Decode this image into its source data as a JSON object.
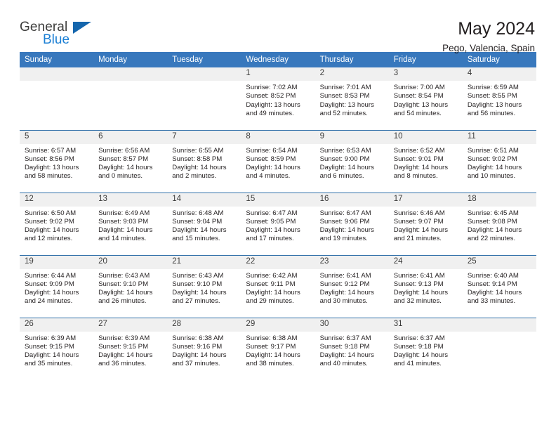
{
  "brand": {
    "name_part1": "General",
    "name_part2": "Blue",
    "triangle_icon": "brand-triangle-icon",
    "color_primary": "#1b7fd4",
    "color_dark": "#3c3c3b"
  },
  "header": {
    "title": "May 2024",
    "subtitle": "Pego, Valencia, Spain"
  },
  "theme": {
    "header_bg": "#3878bd",
    "daynum_bg": "#f0f0f0",
    "row_border": "#2f6fa8"
  },
  "weekday_headers": [
    "Sunday",
    "Monday",
    "Tuesday",
    "Wednesday",
    "Thursday",
    "Friday",
    "Saturday"
  ],
  "labels": {
    "sunrise_prefix": "Sunrise:",
    "sunset_prefix": "Sunset:",
    "daylight_prefix": "Daylight:"
  },
  "weeks": [
    [
      {
        "day": "",
        "sunrise": "",
        "sunset": "",
        "daylight": "",
        "empty": true
      },
      {
        "day": "",
        "sunrise": "",
        "sunset": "",
        "daylight": "",
        "empty": true
      },
      {
        "day": "",
        "sunrise": "",
        "sunset": "",
        "daylight": "",
        "empty": true
      },
      {
        "day": "1",
        "sunrise": "Sunrise: 7:02 AM",
        "sunset": "Sunset: 8:52 PM",
        "daylight": "Daylight: 13 hours and 49 minutes.",
        "empty": false
      },
      {
        "day": "2",
        "sunrise": "Sunrise: 7:01 AM",
        "sunset": "Sunset: 8:53 PM",
        "daylight": "Daylight: 13 hours and 52 minutes.",
        "empty": false
      },
      {
        "day": "3",
        "sunrise": "Sunrise: 7:00 AM",
        "sunset": "Sunset: 8:54 PM",
        "daylight": "Daylight: 13 hours and 54 minutes.",
        "empty": false
      },
      {
        "day": "4",
        "sunrise": "Sunrise: 6:59 AM",
        "sunset": "Sunset: 8:55 PM",
        "daylight": "Daylight: 13 hours and 56 minutes.",
        "empty": false
      }
    ],
    [
      {
        "day": "5",
        "sunrise": "Sunrise: 6:57 AM",
        "sunset": "Sunset: 8:56 PM",
        "daylight": "Daylight: 13 hours and 58 minutes.",
        "empty": false
      },
      {
        "day": "6",
        "sunrise": "Sunrise: 6:56 AM",
        "sunset": "Sunset: 8:57 PM",
        "daylight": "Daylight: 14 hours and 0 minutes.",
        "empty": false
      },
      {
        "day": "7",
        "sunrise": "Sunrise: 6:55 AM",
        "sunset": "Sunset: 8:58 PM",
        "daylight": "Daylight: 14 hours and 2 minutes.",
        "empty": false
      },
      {
        "day": "8",
        "sunrise": "Sunrise: 6:54 AM",
        "sunset": "Sunset: 8:59 PM",
        "daylight": "Daylight: 14 hours and 4 minutes.",
        "empty": false
      },
      {
        "day": "9",
        "sunrise": "Sunrise: 6:53 AM",
        "sunset": "Sunset: 9:00 PM",
        "daylight": "Daylight: 14 hours and 6 minutes.",
        "empty": false
      },
      {
        "day": "10",
        "sunrise": "Sunrise: 6:52 AM",
        "sunset": "Sunset: 9:01 PM",
        "daylight": "Daylight: 14 hours and 8 minutes.",
        "empty": false
      },
      {
        "day": "11",
        "sunrise": "Sunrise: 6:51 AM",
        "sunset": "Sunset: 9:02 PM",
        "daylight": "Daylight: 14 hours and 10 minutes.",
        "empty": false
      }
    ],
    [
      {
        "day": "12",
        "sunrise": "Sunrise: 6:50 AM",
        "sunset": "Sunset: 9:02 PM",
        "daylight": "Daylight: 14 hours and 12 minutes.",
        "empty": false
      },
      {
        "day": "13",
        "sunrise": "Sunrise: 6:49 AM",
        "sunset": "Sunset: 9:03 PM",
        "daylight": "Daylight: 14 hours and 14 minutes.",
        "empty": false
      },
      {
        "day": "14",
        "sunrise": "Sunrise: 6:48 AM",
        "sunset": "Sunset: 9:04 PM",
        "daylight": "Daylight: 14 hours and 15 minutes.",
        "empty": false
      },
      {
        "day": "15",
        "sunrise": "Sunrise: 6:47 AM",
        "sunset": "Sunset: 9:05 PM",
        "daylight": "Daylight: 14 hours and 17 minutes.",
        "empty": false
      },
      {
        "day": "16",
        "sunrise": "Sunrise: 6:47 AM",
        "sunset": "Sunset: 9:06 PM",
        "daylight": "Daylight: 14 hours and 19 minutes.",
        "empty": false
      },
      {
        "day": "17",
        "sunrise": "Sunrise: 6:46 AM",
        "sunset": "Sunset: 9:07 PM",
        "daylight": "Daylight: 14 hours and 21 minutes.",
        "empty": false
      },
      {
        "day": "18",
        "sunrise": "Sunrise: 6:45 AM",
        "sunset": "Sunset: 9:08 PM",
        "daylight": "Daylight: 14 hours and 22 minutes.",
        "empty": false
      }
    ],
    [
      {
        "day": "19",
        "sunrise": "Sunrise: 6:44 AM",
        "sunset": "Sunset: 9:09 PM",
        "daylight": "Daylight: 14 hours and 24 minutes.",
        "empty": false
      },
      {
        "day": "20",
        "sunrise": "Sunrise: 6:43 AM",
        "sunset": "Sunset: 9:10 PM",
        "daylight": "Daylight: 14 hours and 26 minutes.",
        "empty": false
      },
      {
        "day": "21",
        "sunrise": "Sunrise: 6:43 AM",
        "sunset": "Sunset: 9:10 PM",
        "daylight": "Daylight: 14 hours and 27 minutes.",
        "empty": false
      },
      {
        "day": "22",
        "sunrise": "Sunrise: 6:42 AM",
        "sunset": "Sunset: 9:11 PM",
        "daylight": "Daylight: 14 hours and 29 minutes.",
        "empty": false
      },
      {
        "day": "23",
        "sunrise": "Sunrise: 6:41 AM",
        "sunset": "Sunset: 9:12 PM",
        "daylight": "Daylight: 14 hours and 30 minutes.",
        "empty": false
      },
      {
        "day": "24",
        "sunrise": "Sunrise: 6:41 AM",
        "sunset": "Sunset: 9:13 PM",
        "daylight": "Daylight: 14 hours and 32 minutes.",
        "empty": false
      },
      {
        "day": "25",
        "sunrise": "Sunrise: 6:40 AM",
        "sunset": "Sunset: 9:14 PM",
        "daylight": "Daylight: 14 hours and 33 minutes.",
        "empty": false
      }
    ],
    [
      {
        "day": "26",
        "sunrise": "Sunrise: 6:39 AM",
        "sunset": "Sunset: 9:15 PM",
        "daylight": "Daylight: 14 hours and 35 minutes.",
        "empty": false
      },
      {
        "day": "27",
        "sunrise": "Sunrise: 6:39 AM",
        "sunset": "Sunset: 9:15 PM",
        "daylight": "Daylight: 14 hours and 36 minutes.",
        "empty": false
      },
      {
        "day": "28",
        "sunrise": "Sunrise: 6:38 AM",
        "sunset": "Sunset: 9:16 PM",
        "daylight": "Daylight: 14 hours and 37 minutes.",
        "empty": false
      },
      {
        "day": "29",
        "sunrise": "Sunrise: 6:38 AM",
        "sunset": "Sunset: 9:17 PM",
        "daylight": "Daylight: 14 hours and 38 minutes.",
        "empty": false
      },
      {
        "day": "30",
        "sunrise": "Sunrise: 6:37 AM",
        "sunset": "Sunset: 9:18 PM",
        "daylight": "Daylight: 14 hours and 40 minutes.",
        "empty": false
      },
      {
        "day": "31",
        "sunrise": "Sunrise: 6:37 AM",
        "sunset": "Sunset: 9:18 PM",
        "daylight": "Daylight: 14 hours and 41 minutes.",
        "empty": false
      },
      {
        "day": "",
        "sunrise": "",
        "sunset": "",
        "daylight": "",
        "empty": true
      }
    ]
  ]
}
